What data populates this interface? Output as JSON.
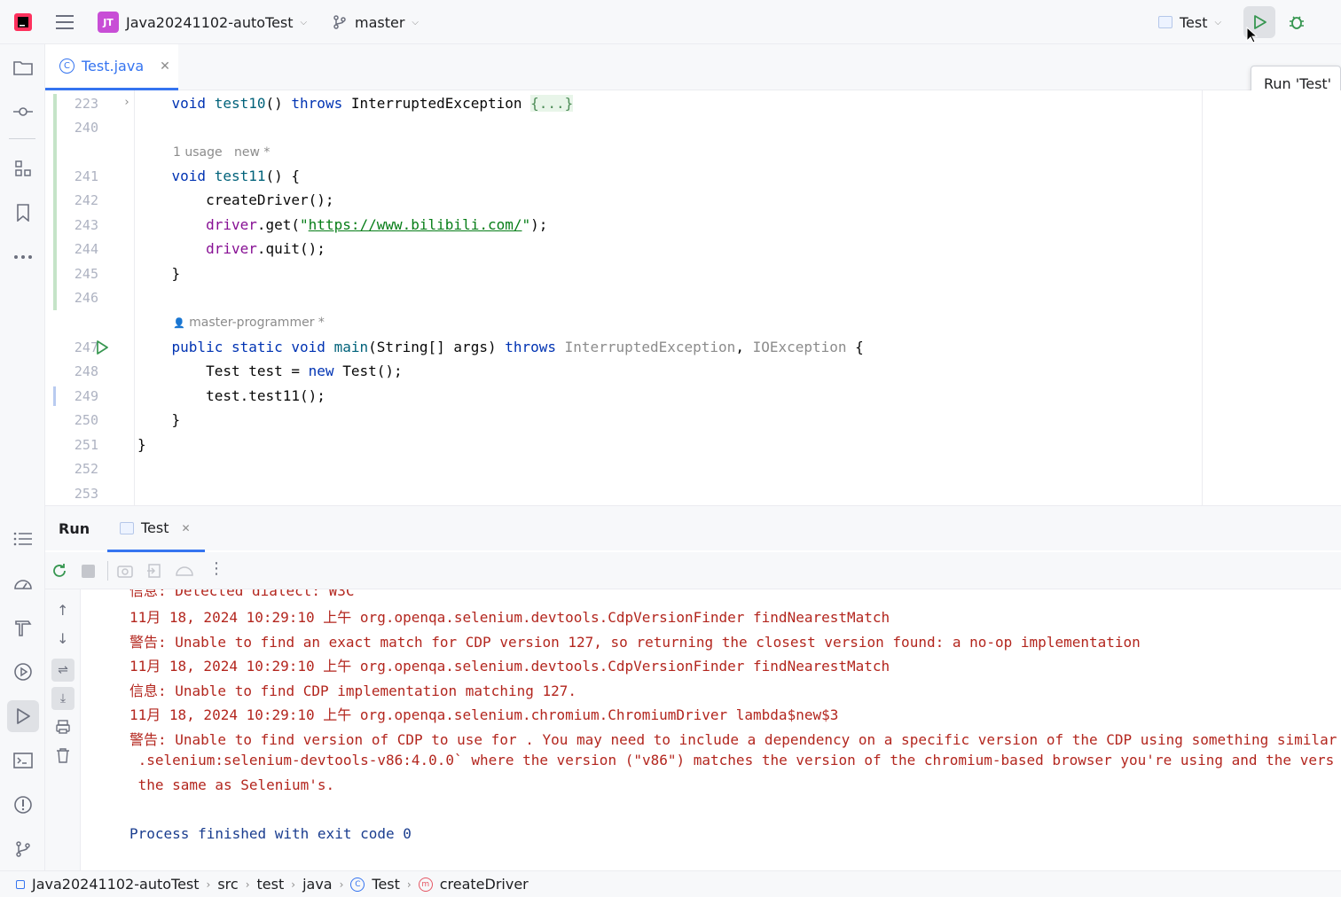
{
  "titlebar": {
    "project_badge": "JT",
    "project_name": "Java20241102-autoTest",
    "branch": "master",
    "run_config": "Test",
    "tooltip": "Run 'Test'"
  },
  "editor_tab": {
    "label": "Test.java"
  },
  "editor": {
    "lines": [
      {
        "num": "223",
        "text": "void test10() throws InterruptedException {...}"
      },
      {
        "num": "240",
        "text": ""
      },
      {
        "num": "241",
        "text": "void test11() {"
      },
      {
        "num": "242",
        "text": "createDriver();"
      },
      {
        "num": "243",
        "text": "driver.get(\"https://www.bilibili.com/\");"
      },
      {
        "num": "244",
        "text": "driver.quit();"
      },
      {
        "num": "245",
        "text": "}"
      },
      {
        "num": "246",
        "text": ""
      },
      {
        "num": "247",
        "text": "public static void main(String[] args) throws InterruptedException, IOException {"
      },
      {
        "num": "248",
        "text": "Test test = new Test();"
      },
      {
        "num": "249",
        "text": "test.test11();"
      },
      {
        "num": "250",
        "text": "}"
      },
      {
        "num": "251",
        "text": "}"
      },
      {
        "num": "252",
        "text": ""
      },
      {
        "num": "253",
        "text": ""
      }
    ],
    "hint_usage": "1 usage",
    "hint_new": "new *",
    "hint_author": "master-programmer *",
    "url": "https://www.bilibili.com/"
  },
  "toolwindow": {
    "title": "Run",
    "tab": "Test",
    "output": [
      "信息: Detected dialect: W3C",
      "11月 18, 2024 10:29:10 上午 org.openqa.selenium.devtools.CdpVersionFinder findNearestMatch",
      "警告: Unable to find an exact match for CDP version 127, so returning the closest version found: a no-op implementation",
      "11月 18, 2024 10:29:10 上午 org.openqa.selenium.devtools.CdpVersionFinder findNearestMatch",
      "信息: Unable to find CDP implementation matching 127.",
      "11月 18, 2024 10:29:10 上午 org.openqa.selenium.chromium.ChromiumDriver lambda$new$3",
      "警告: Unable to find version of CDP to use for . You may need to include a dependency on a specific version of the CDP using something similar",
      " .selenium:selenium-devtools-v86:4.0.0` where the version (\"v86\") matches the version of the chromium-based browser you're using and the vers",
      " the same as Selenium's."
    ],
    "finished": "Process finished with exit code 0"
  },
  "statusbar": {
    "crumbs": [
      "Java20241102-autoTest",
      "src",
      "test",
      "java",
      "Test",
      "createDriver"
    ]
  }
}
